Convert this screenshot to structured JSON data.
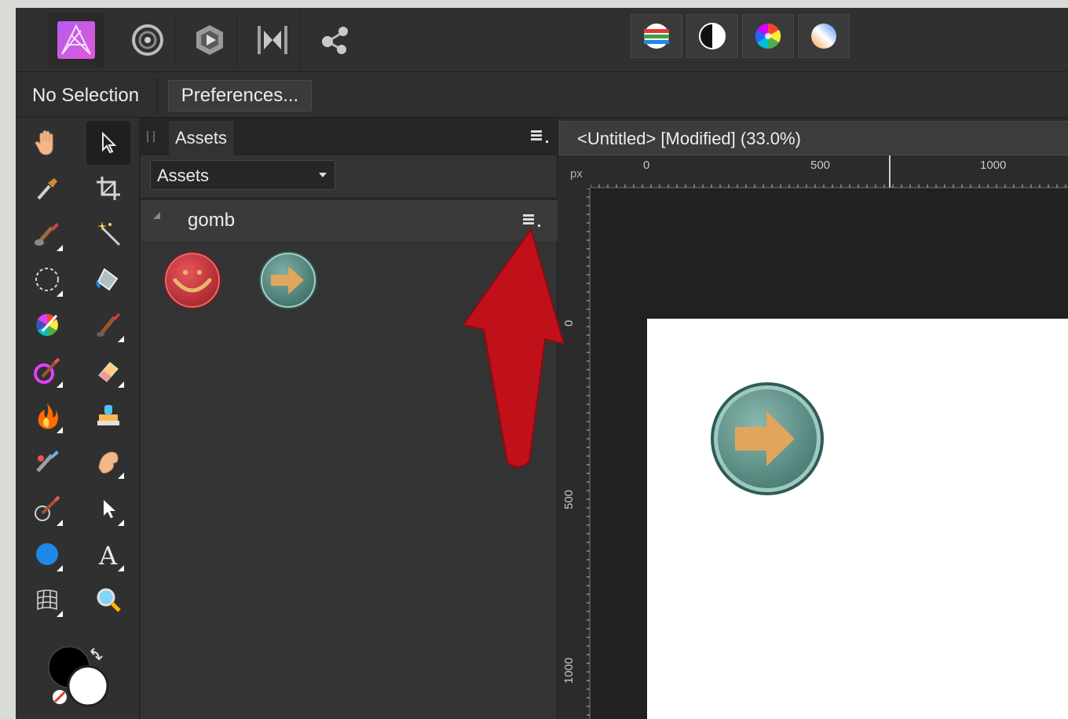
{
  "personas": {
    "items": [
      "Photo Persona",
      "Liquify Persona",
      "Develop Persona",
      "Tone Mapping Persona",
      "Export Persona"
    ],
    "active": "Photo Persona"
  },
  "studio_buttons": [
    "Histogram",
    "Black and White",
    "Color Wheel",
    "Gradient"
  ],
  "context": {
    "selection_label": "No Selection",
    "preferences_label": "Preferences..."
  },
  "tools": [
    "View Tool",
    "Move Tool",
    "Color Picker Tool",
    "Crop Tool",
    "Selection Brush Tool",
    "Flood Select Tool",
    "Marquee Tool",
    "Flood Fill Tool",
    "Color Replacement Tool",
    "Paint Brush Tool",
    "Dodge Brush Tool",
    "Erase Brush Tool",
    "Burn Tool",
    "Clone Brush Tool",
    "Blemish Removal Tool",
    "Smudge Brush Tool",
    "Pixel Tool",
    "Node Tool",
    "Ellipse Tool",
    "Artistic Text Tool",
    "Mesh Warp Tool",
    "Zoom Tool"
  ],
  "assets_panel": {
    "tab_label": "Assets",
    "dropdown_value": "Assets",
    "category": "gomb",
    "items": [
      "Smiley button",
      "Arrow button"
    ]
  },
  "document": {
    "title": "<Untitled> [Modified] (33.0%)"
  },
  "rulers": {
    "unit": "px",
    "top_labels": [
      "0",
      "500",
      "1000"
    ],
    "left_labels": [
      "0",
      "500",
      "1000"
    ]
  },
  "colors": {
    "annotation_arrow": "#c0101a",
    "app_bg": "#2b2b2b",
    "button_teal": "#4f8f84",
    "button_red": "#c8323a",
    "arrow_glyph": "#e2a55c"
  }
}
